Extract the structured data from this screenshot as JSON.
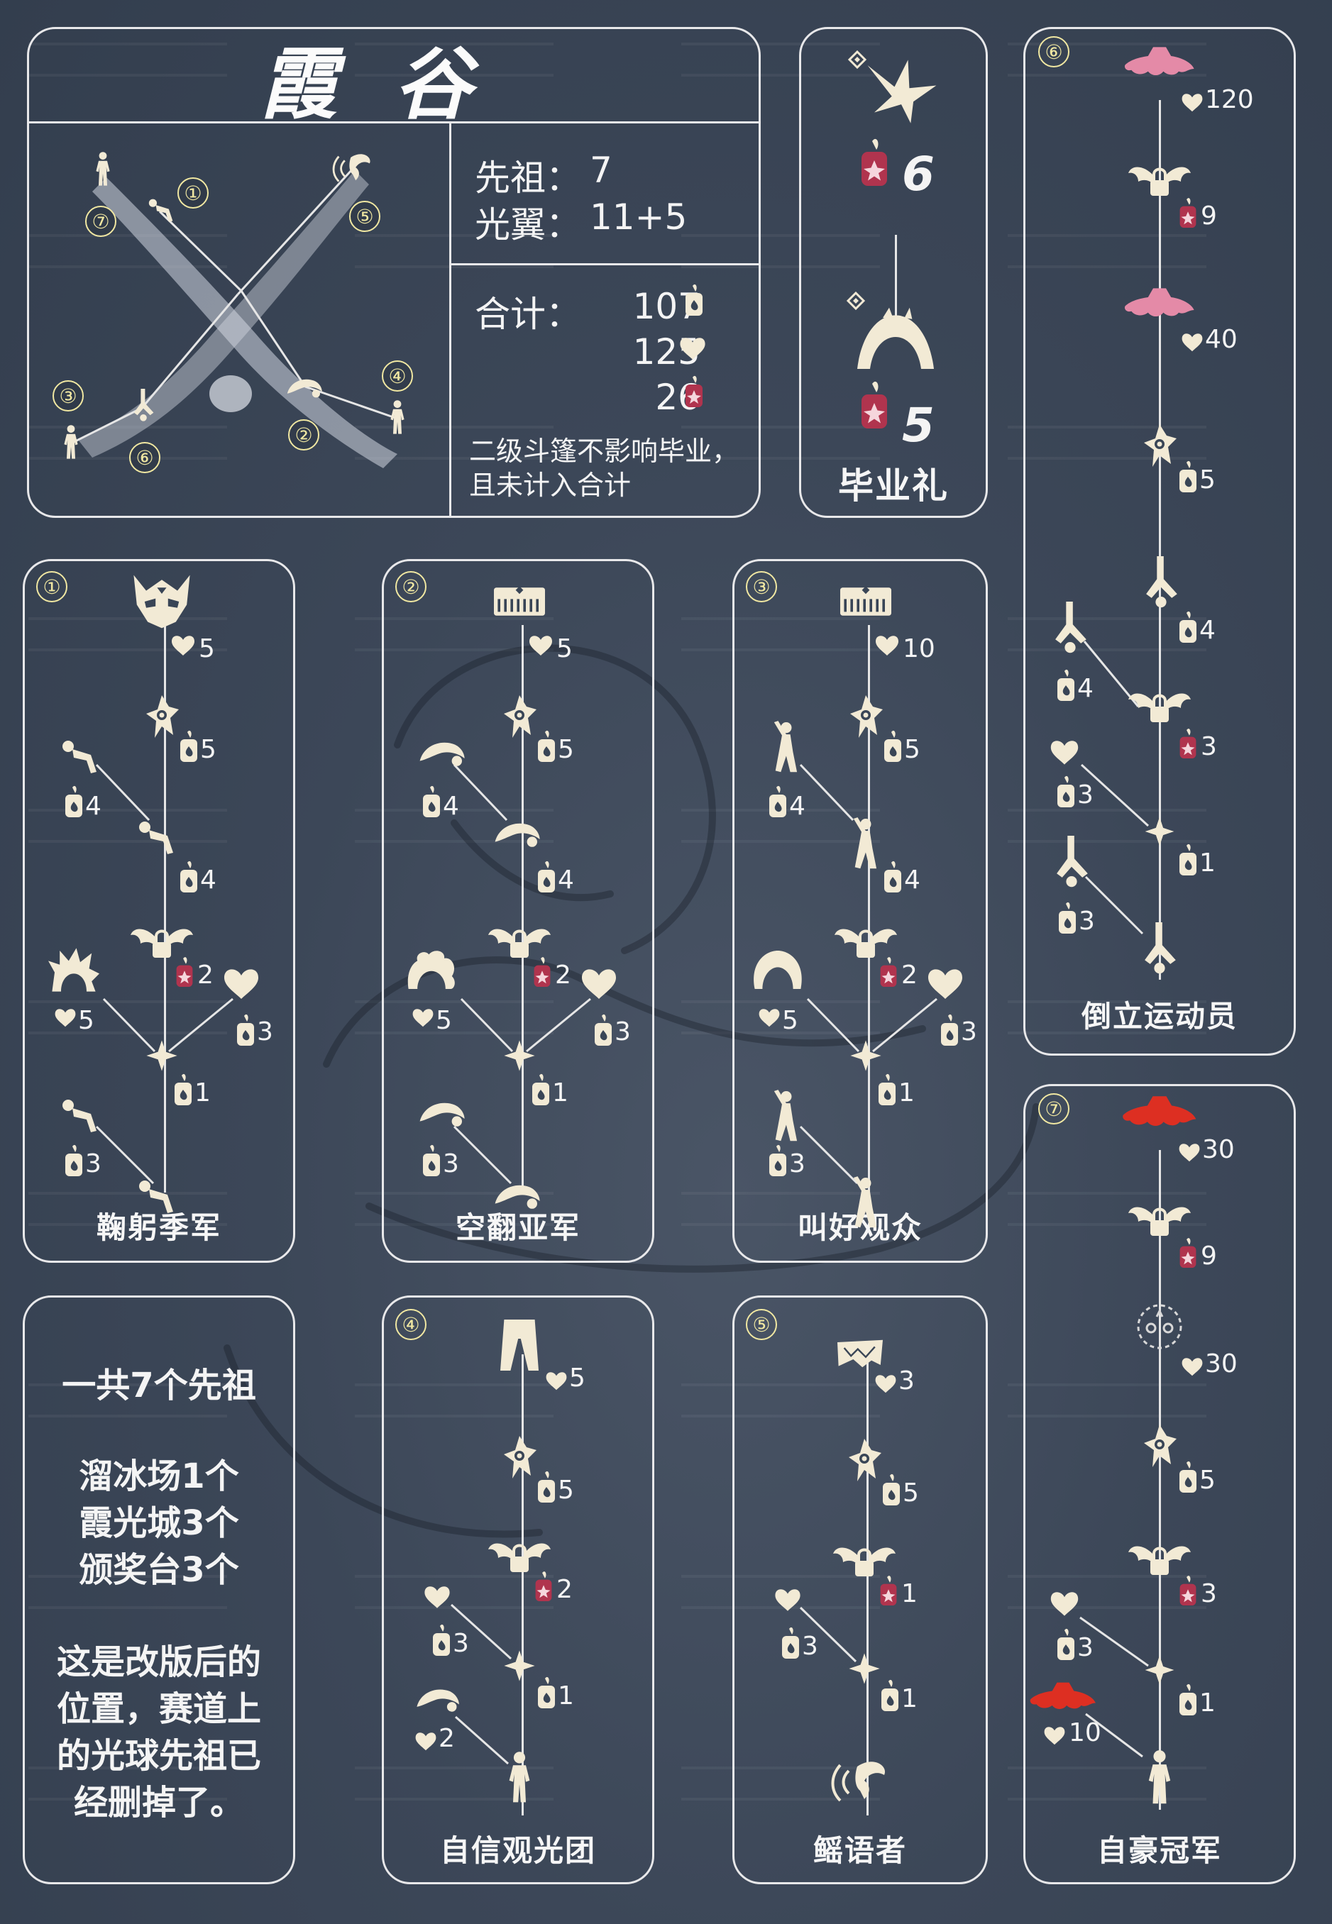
{
  "header": {
    "title": "霞谷"
  },
  "map": {
    "markers": [
      "①",
      "⑦",
      "⑤",
      "③",
      "⑥",
      "②",
      "④"
    ]
  },
  "summary": {
    "ancestors_label": "先祖：",
    "ancestors_value": "7",
    "wings_label": "光翼：",
    "wings_value": "11+5",
    "total_label": "合计：",
    "total_candles": "107",
    "total_hearts": "125",
    "total_ascended": "26",
    "note_line1": "二级斗篷不影响毕业，",
    "note_line2": "且未计入合计"
  },
  "graduation": {
    "cost_top": "6",
    "cost_bottom": "5",
    "label": "毕业礼"
  },
  "panels": {
    "p1": {
      "marker": "①",
      "title": "鞠躬季军",
      "costs": [
        "5",
        "5",
        "4",
        "4",
        "2",
        "5",
        "3",
        "1",
        "3"
      ]
    },
    "p2": {
      "marker": "②",
      "title": "空翻亚军",
      "costs": [
        "5",
        "5",
        "4",
        "4",
        "2",
        "5",
        "3",
        "1",
        "3"
      ]
    },
    "p3": {
      "marker": "③",
      "title": "叫好观众",
      "costs": [
        "10",
        "5",
        "4",
        "4",
        "2",
        "5",
        "3",
        "1",
        "3"
      ]
    },
    "p4": {
      "marker": "④",
      "title": "自信观光团",
      "costs": [
        "5",
        "5",
        "2",
        "3",
        "1",
        "2"
      ]
    },
    "p5": {
      "marker": "⑤",
      "title": "鳐语者",
      "costs": [
        "3",
        "5",
        "1",
        "3",
        "1"
      ]
    },
    "p6": {
      "marker": "⑥",
      "title": "倒立运动员",
      "costs": [
        "120",
        "9",
        "40",
        "5",
        "4",
        "4",
        "3",
        "3",
        "1",
        "3"
      ]
    },
    "p7": {
      "marker": "⑦",
      "title": "自豪冠军",
      "costs": [
        "30",
        "9",
        "30",
        "5",
        "3",
        "3",
        "1",
        "10"
      ]
    }
  },
  "info": {
    "line1": "一共7个先祖",
    "line2": "溜冰场1个",
    "line3": "霞光城3个",
    "line4": "颁奖台3个",
    "line5": "这是改版后的",
    "line6": "位置，赛道上",
    "line7": "的光球先祖已",
    "line8": "经删掉了。"
  },
  "colors": {
    "background": "#394556",
    "border": "#e8e8ea",
    "marker": "#f1e8a2",
    "icon": "#f2ead5",
    "ascended": "#b0344e",
    "cape_pink": "#e48aa7",
    "cape_red": "#dd2f22"
  }
}
